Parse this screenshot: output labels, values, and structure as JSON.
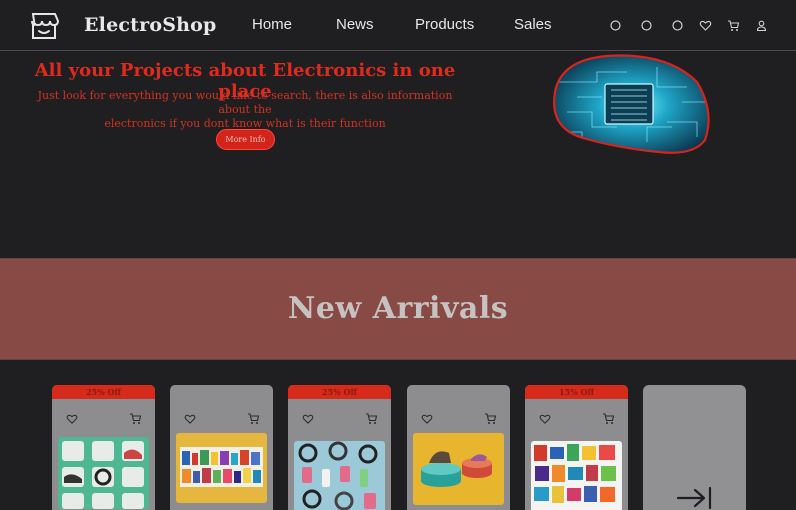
{
  "header": {
    "brand": "ElectroShop",
    "nav": [
      "Home",
      "News",
      "Products",
      "Sales"
    ],
    "icons": [
      "circle-icon",
      "circle-icon",
      "circle-icon",
      "heart-icon",
      "cart-icon",
      "user-icon"
    ]
  },
  "hero": {
    "title": "All your Projects about Electronics in one place",
    "subtitle_line1": "Just look for everything you would like to search, there is also information about the",
    "subtitle_line2": "electronics if you dont know what is their function",
    "button": "More Info"
  },
  "banner": {
    "title": "New Arrivals"
  },
  "products": [
    {
      "badge": "25% Off",
      "image": "sneakers-and-headphones"
    },
    {
      "badge": "",
      "image": "shelf-of-products"
    },
    {
      "badge": "25% Off",
      "image": "headphones-and-bottles"
    },
    {
      "badge": "",
      "image": "shoe-on-pedestals"
    },
    {
      "badge": "15% Off",
      "image": "snack-packages"
    }
  ],
  "colors": {
    "accent": "#e02a1e",
    "banner": "#874a44",
    "background": "#1f1f22",
    "card": "#8d8d90"
  }
}
